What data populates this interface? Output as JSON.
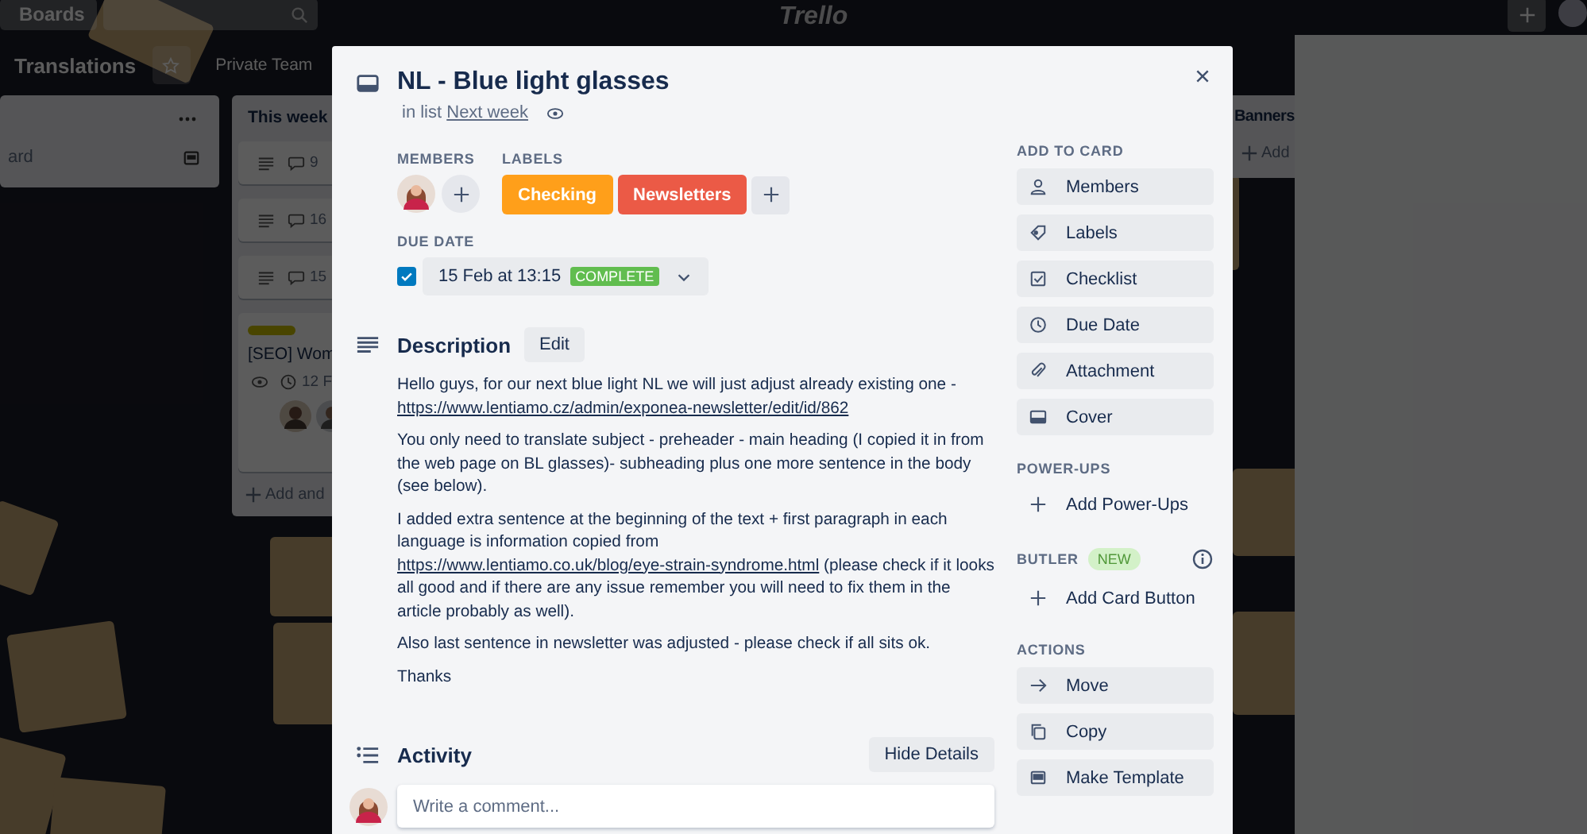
{
  "header": {
    "boards_button": "Boards",
    "logo": "Trello"
  },
  "board": {
    "title": "Translations",
    "team": "Private Team"
  },
  "lists": [
    {
      "kind": "stub",
      "footer": "ard"
    },
    {
      "kind": "full",
      "title": "This week",
      "add": "Add and",
      "cards": [
        {
          "kind": "comments",
          "comments": "9"
        },
        {
          "kind": "comments",
          "comments": "16"
        },
        {
          "kind": "comments",
          "comments": "15"
        },
        {
          "kind": "detailed",
          "title": "[SEO] Wom",
          "due": "12 F"
        }
      ]
    },
    {
      "kind": "short",
      "title": "Banners",
      "add": "Add"
    }
  ],
  "card": {
    "title": "NL - Blue light glasses",
    "list_prefix": "in list",
    "list_name": "Next week",
    "members_heading": "MEMBERS",
    "labels_heading": "LABELS",
    "labels": [
      {
        "text": "Checking",
        "color": "#ff9f1a"
      },
      {
        "text": "Newsletters",
        "color": "#eb5a46"
      }
    ],
    "due_heading": "DUE DATE",
    "due": {
      "checked": true,
      "date": "15 Feb at 13:15",
      "badge": "COMPLETE"
    },
    "description": {
      "heading": "Description",
      "edit": "Edit",
      "paragraphs": [
        [
          {
            "kind": "text",
            "text": "Hello guys, for our next blue light NL we will just adjust already existing one - "
          },
          {
            "kind": "link",
            "text": "https://www.lentiamo.cz/admin/exponea-newsletter/edit/id/862"
          }
        ],
        [
          {
            "kind": "text",
            "text": "You only need to translate subject - preheader - main heading (I copied it in from the web page on BL glasses)- subheading plus one more sentence in the body (see below)."
          }
        ],
        [
          {
            "kind": "text",
            "text": "I added extra sentence at the beginning of the text + first paragraph in each language is information copied from "
          },
          {
            "kind": "link",
            "text": "https://www.lentiamo.co.uk/blog/eye-strain-syndrome.html"
          },
          {
            "kind": "text",
            "text": " (please check if it looks all good and if there are any issue remember you will need to fix them in the article probably as well)."
          }
        ],
        [
          {
            "kind": "text",
            "text": "Also last sentence in newsletter was adjusted - please check if all sits ok."
          }
        ],
        [
          {
            "kind": "text",
            "text": "Thanks"
          }
        ]
      ]
    },
    "activity": {
      "heading": "Activity",
      "button": "Hide Details",
      "placeholder": "Write a comment..."
    },
    "sidebar": [
      {
        "heading": "ADD TO CARD",
        "items": [
          {
            "kind": "button",
            "label": "Members"
          },
          {
            "kind": "button",
            "label": "Labels"
          },
          {
            "kind": "button",
            "label": "Checklist"
          },
          {
            "kind": "button",
            "label": "Due Date"
          },
          {
            "kind": "button",
            "label": "Attachment"
          },
          {
            "kind": "button",
            "label": "Cover"
          }
        ]
      },
      {
        "heading": "POWER-UPS",
        "items": [
          {
            "kind": "add",
            "label": "Add Power-Ups"
          }
        ]
      },
      {
        "heading": "BUTLER",
        "badge": "NEW",
        "items": [
          {
            "kind": "add",
            "label": "Add Card Button"
          }
        ]
      },
      {
        "heading": "ACTIONS",
        "items": [
          {
            "kind": "button",
            "label": "Move"
          },
          {
            "kind": "button",
            "label": "Copy"
          },
          {
            "kind": "button",
            "label": "Make Template"
          }
        ]
      }
    ]
  }
}
